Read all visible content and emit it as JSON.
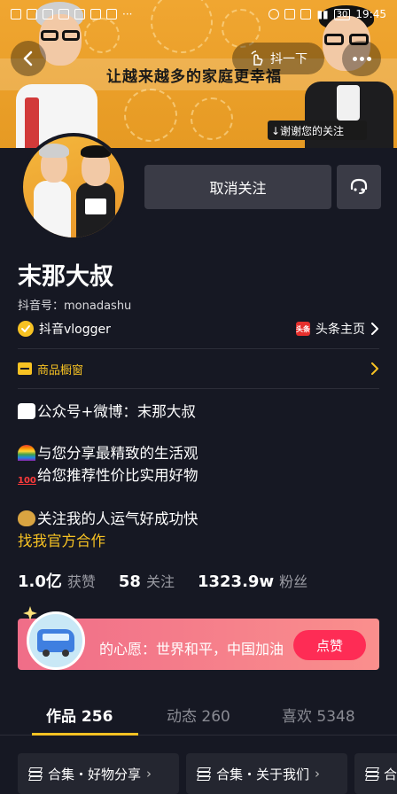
{
  "status_bar": {
    "time": "19:45",
    "battery": "30"
  },
  "banner": {
    "caption": "让越来越多的家庭更幸福",
    "thanks_badge": "↓谢谢您的关注",
    "shake_label": "抖一下"
  },
  "profile": {
    "name": "末那大叔",
    "douyin_id": "抖音号：monadashu",
    "verified_label": "抖音vlogger",
    "toutiao_label": "头条主页",
    "toutiao_logo": "头条",
    "unfollow_label": "取消关注"
  },
  "shop": {
    "label": "商品橱窗"
  },
  "bio": {
    "line1": "公众号+微博：末那大叔",
    "line2": "与您分享最精致的生活观",
    "line3": "给您推荐性价比实用好物",
    "line4": "关注我的人运气好成功快",
    "official": "找我官方合作"
  },
  "stats": [
    {
      "num": "1.0亿",
      "label": "获赞"
    },
    {
      "num": "58",
      "label": "关注"
    },
    {
      "num": "1323.9w",
      "label": "粉丝"
    }
  ],
  "wish": {
    "text": "的心愿：世界和平，中国加油",
    "button": "点赞"
  },
  "tabs": [
    {
      "label": "作品 256",
      "active": true
    },
    {
      "label": "动态 260",
      "active": false
    },
    {
      "label": "喜欢 5348",
      "active": false
    }
  ],
  "collections": [
    {
      "label": "合集・好物分享"
    },
    {
      "label": "合集・关于我们"
    },
    {
      "label": "合"
    }
  ],
  "colors": {
    "background": "#161823",
    "accent_yellow": "#f7c223",
    "like_red": "#fe2c55"
  }
}
